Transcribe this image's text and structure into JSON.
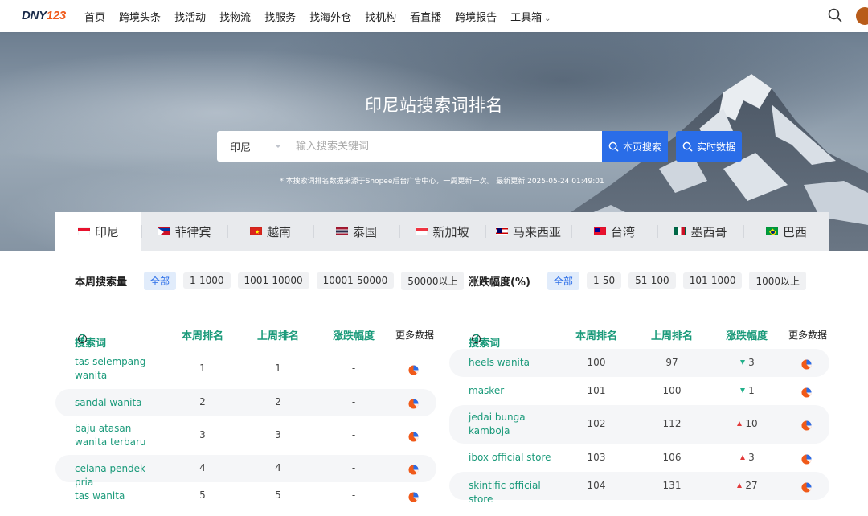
{
  "logo": {
    "part1": "DNY",
    "part2": "123"
  },
  "nav": {
    "items": [
      "首页",
      "跨境头条",
      "找活动",
      "找物流",
      "找服务",
      "找海外仓",
      "找机构",
      "看直播",
      "跨境报告",
      "工具箱"
    ]
  },
  "hero": {
    "title": "印尼站搜索词排名",
    "country_select": "印尼",
    "search_placeholder": "输入搜索关键词",
    "btn_page_search": "本页搜索",
    "btn_realtime": "实时数据",
    "note": "* 本搜索词排名数据来源于Shopee后台广告中心，一周更新一次。 最新更新 2025-05-24 01:49:01"
  },
  "tabs": [
    "印尼",
    "菲律宾",
    "越南",
    "泰国",
    "新加坡",
    "马来西亚",
    "台湾",
    "墨西哥",
    "巴西"
  ],
  "filters": {
    "volume": {
      "label": "本周搜索量",
      "options": [
        "全部",
        "1-1000",
        "1001-10000",
        "10001-50000",
        "50000以上"
      ]
    },
    "change": {
      "label": "涨跌幅度(%)",
      "options": [
        "全部",
        "1-50",
        "51-100",
        "101-1000",
        "1000以上"
      ]
    }
  },
  "table_headers": {
    "keyword": "搜索词",
    "this_week": "本周排名",
    "last_week": "上周排名",
    "change": "涨跌幅度",
    "more": "更多数据"
  },
  "left_rows": [
    {
      "keyword": "tas selempang wanita",
      "rank": "1",
      "last": "1",
      "change": "-"
    },
    {
      "keyword": "sandal wanita",
      "rank": "2",
      "last": "2",
      "change": "-"
    },
    {
      "keyword": "baju atasan wanita terbaru",
      "rank": "3",
      "last": "3",
      "change": "-"
    },
    {
      "keyword": "celana pendek pria",
      "rank": "4",
      "last": "4",
      "change": "-"
    },
    {
      "keyword": "tas wanita",
      "rank": "5",
      "last": "5",
      "change": "-"
    }
  ],
  "right_rows": [
    {
      "keyword": "heels wanita",
      "rank": "100",
      "last": "97",
      "change": "3",
      "dir": "down"
    },
    {
      "keyword": "masker",
      "rank": "101",
      "last": "100",
      "change": "1",
      "dir": "down"
    },
    {
      "keyword": "jedai bunga kamboja",
      "rank": "102",
      "last": "112",
      "change": "10",
      "dir": "up"
    },
    {
      "keyword": "ibox official store",
      "rank": "103",
      "last": "106",
      "change": "3",
      "dir": "up"
    },
    {
      "keyword": "skintific official store",
      "rank": "104",
      "last": "131",
      "change": "27",
      "dir": "up"
    }
  ],
  "colors": {
    "accent": "#2a6de8",
    "green": "#1a9a7a",
    "up": "#e23a3a",
    "down": "#22b08a",
    "pie_a": "#f05a1a",
    "pie_b": "#2a6de8"
  }
}
